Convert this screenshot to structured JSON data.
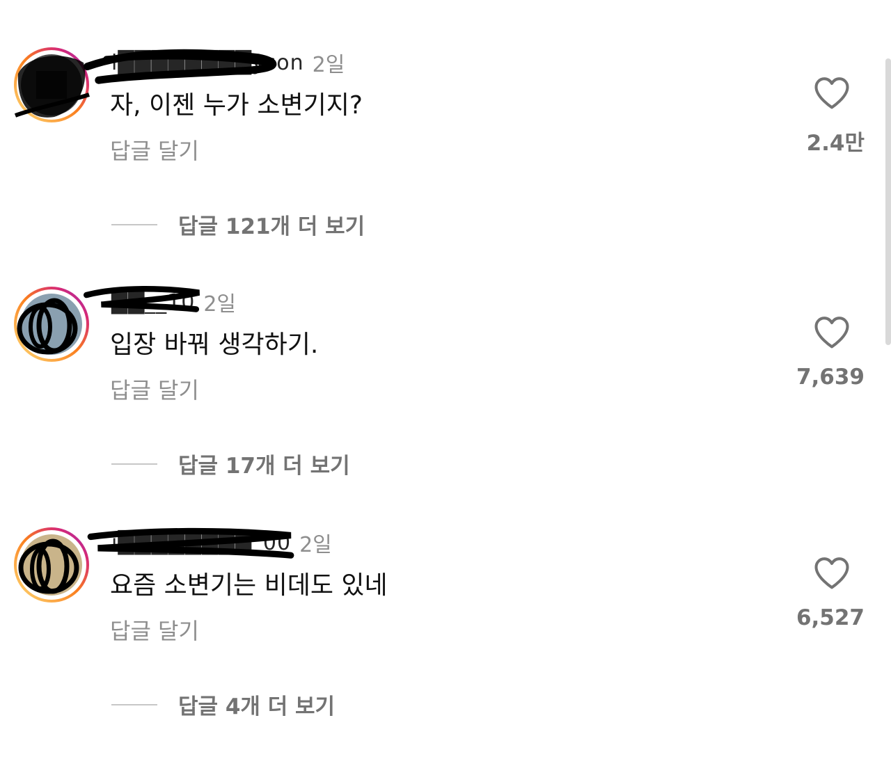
{
  "comments": [
    {
      "username": "i████████yson",
      "time": "2일",
      "text": "자, 이젠 누가 소변기지?",
      "reply_label": "답글 달기",
      "likes": "2.4만",
      "view_replies": "답글 121개 더 보기"
    },
    {
      "username": "██__10",
      "time": "2일",
      "text": "입장 바꿔 생각하기.",
      "reply_label": "답글 달기",
      "likes": "7,639",
      "view_replies": "답글 17개 더 보기"
    },
    {
      "username": "i████████_00",
      "time": "2일",
      "text": "요즘 소변기는 비데도 있네",
      "reply_label": "답글 달기",
      "likes": "6,527",
      "view_replies": "답글 4개 더 보기"
    }
  ],
  "icons": {
    "like": "heart-outline-icon",
    "avatar_ring": "story-gradient-ring"
  },
  "colors": {
    "muted_text": "#8e8e8e",
    "bold_muted": "#737373",
    "ring_start": "#feda75",
    "ring_mid": "#d62976",
    "ring_end": "#962fbf"
  }
}
